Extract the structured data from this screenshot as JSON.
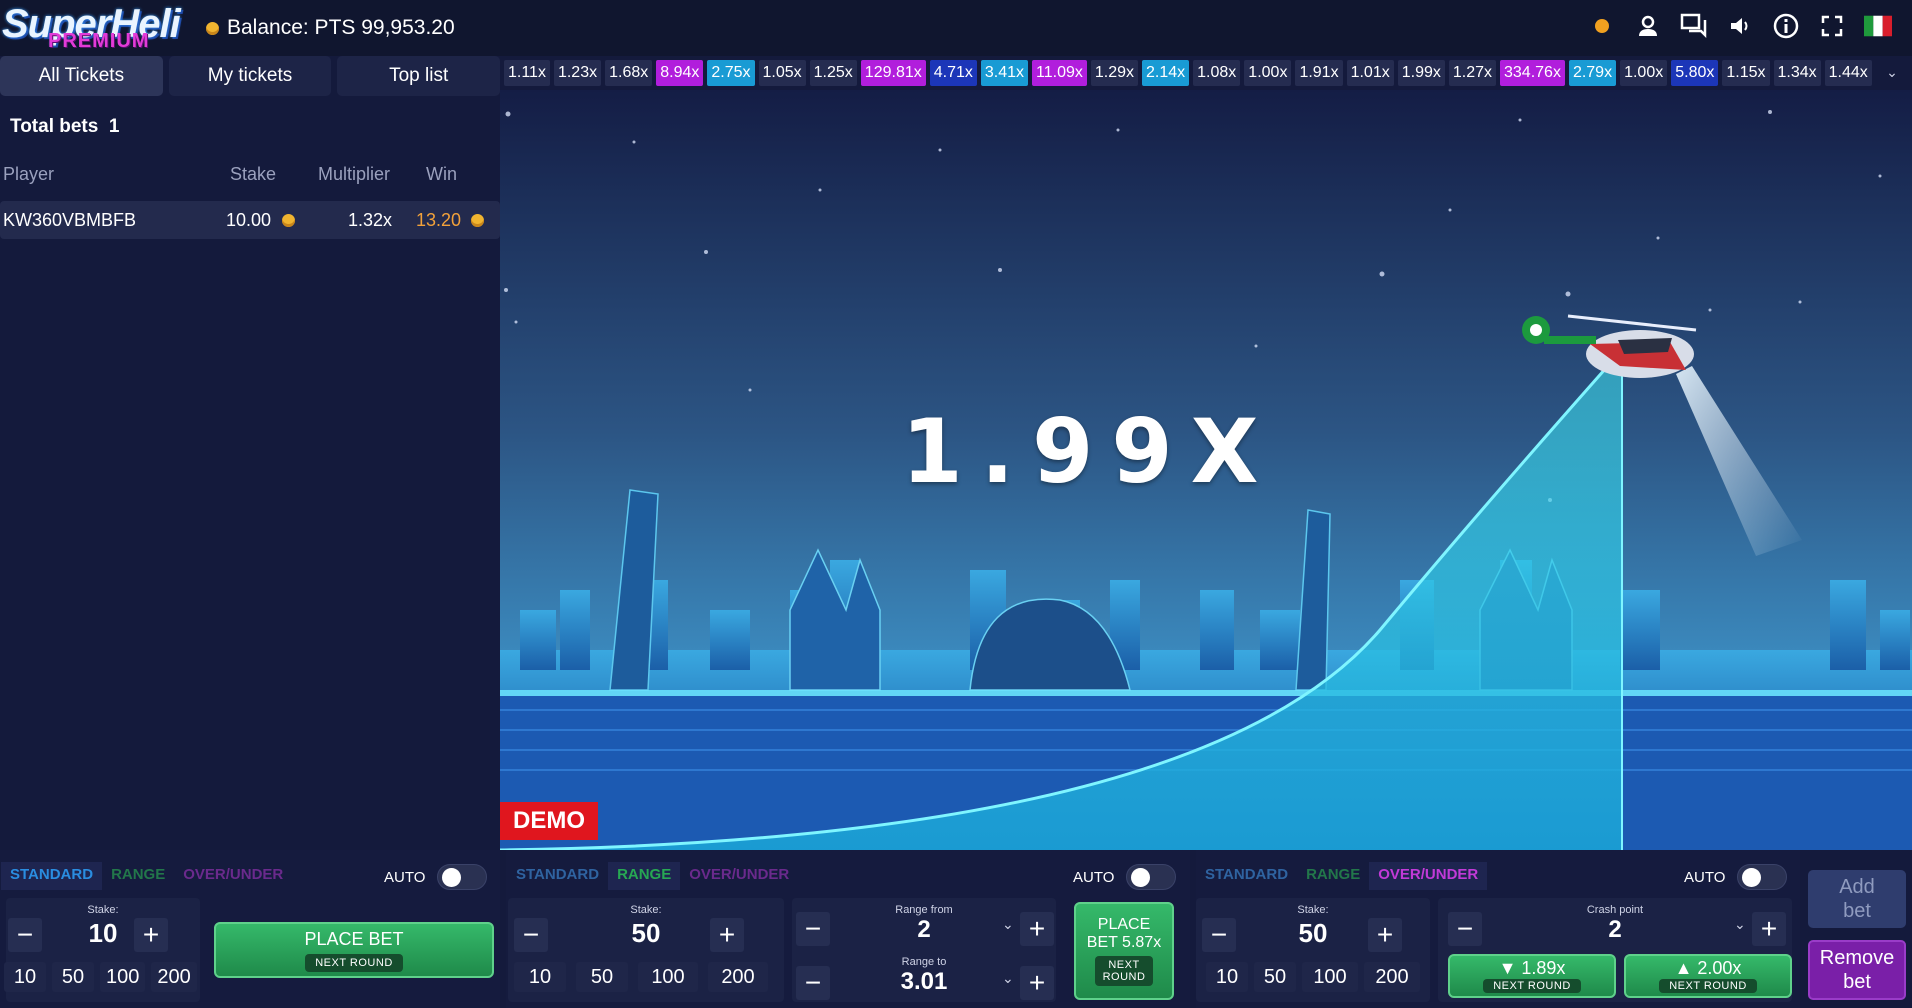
{
  "header": {
    "logo_line1": "SuperHeli",
    "logo_line2": "PREMIUM",
    "balance": "Balance: PTS 99,953.20"
  },
  "top_icons": [
    "status-dot-icon",
    "user-icon",
    "chat-icon",
    "sound-icon",
    "info-icon",
    "fullscreen-icon",
    "italy-flag-icon"
  ],
  "tabs": [
    "All Tickets",
    "My tickets",
    "Top list"
  ],
  "bets": {
    "total_label": "Total bets",
    "total_count": "1",
    "columns": [
      "Player",
      "Stake",
      "Multiplier",
      "Win"
    ],
    "rows": [
      {
        "player": "KW360VBMBFB",
        "stake": "10.00",
        "multiplier": "1.32x",
        "win": "13.20"
      }
    ]
  },
  "history": [
    {
      "v": "1.11x",
      "c": "n"
    },
    {
      "v": "1.23x",
      "c": "n"
    },
    {
      "v": "1.68x",
      "c": "n"
    },
    {
      "v": "8.94x",
      "c": "p"
    },
    {
      "v": "2.75x",
      "c": "b"
    },
    {
      "v": "1.05x",
      "c": "n"
    },
    {
      "v": "1.25x",
      "c": "n"
    },
    {
      "v": "129.81x",
      "c": "p"
    },
    {
      "v": "4.71x",
      "c": "d"
    },
    {
      "v": "3.41x",
      "c": "b"
    },
    {
      "v": "11.09x",
      "c": "p"
    },
    {
      "v": "1.29x",
      "c": "n"
    },
    {
      "v": "2.14x",
      "c": "b"
    },
    {
      "v": "1.08x",
      "c": "n"
    },
    {
      "v": "1.00x",
      "c": "n"
    },
    {
      "v": "1.91x",
      "c": "n"
    },
    {
      "v": "1.01x",
      "c": "n"
    },
    {
      "v": "1.99x",
      "c": "n"
    },
    {
      "v": "1.27x",
      "c": "n"
    },
    {
      "v": "334.76x",
      "c": "p"
    },
    {
      "v": "2.79x",
      "c": "b"
    },
    {
      "v": "1.00x",
      "c": "n"
    },
    {
      "v": "5.80x",
      "c": "d"
    },
    {
      "v": "1.15x",
      "c": "n"
    },
    {
      "v": "1.34x",
      "c": "n"
    },
    {
      "v": "1.44x",
      "c": "n"
    }
  ],
  "game": {
    "multiplier": "1.99X",
    "demo": "DEMO"
  },
  "panel_tabs": {
    "standard": "STANDARD",
    "range": "RANGE",
    "over_under": "OVER/UNDER",
    "auto": "AUTO"
  },
  "panel1": {
    "stake_label": "Stake:",
    "stake": "10",
    "quick": [
      "10",
      "50",
      "100",
      "200"
    ],
    "place": "PLACE BET",
    "next": "NEXT ROUND"
  },
  "panel2": {
    "stake_label": "Stake:",
    "stake": "50",
    "quick": [
      "10",
      "50",
      "100",
      "200"
    ],
    "range_from_label": "Range from",
    "range_from": "2",
    "range_to_label": "Range to",
    "range_to": "3.01",
    "place1": "PLACE",
    "place2": "BET 5.87x",
    "next1": "NEXT",
    "next2": "ROUND"
  },
  "panel3": {
    "stake_label": "Stake:",
    "stake": "50",
    "quick": [
      "10",
      "50",
      "100",
      "200"
    ],
    "crash_label": "Crash point",
    "crash": "2",
    "under": "1.89x",
    "over": "2.00x",
    "next": "NEXT ROUND"
  },
  "side": {
    "add1": "Add",
    "add2": "bet",
    "rem1": "Remove",
    "rem2": "bet"
  },
  "colors": {
    "purple": "#b11edc",
    "cyan": "#199bd4",
    "blue": "#1c36b8",
    "green": "#27a853",
    "red": "#e0161e"
  }
}
